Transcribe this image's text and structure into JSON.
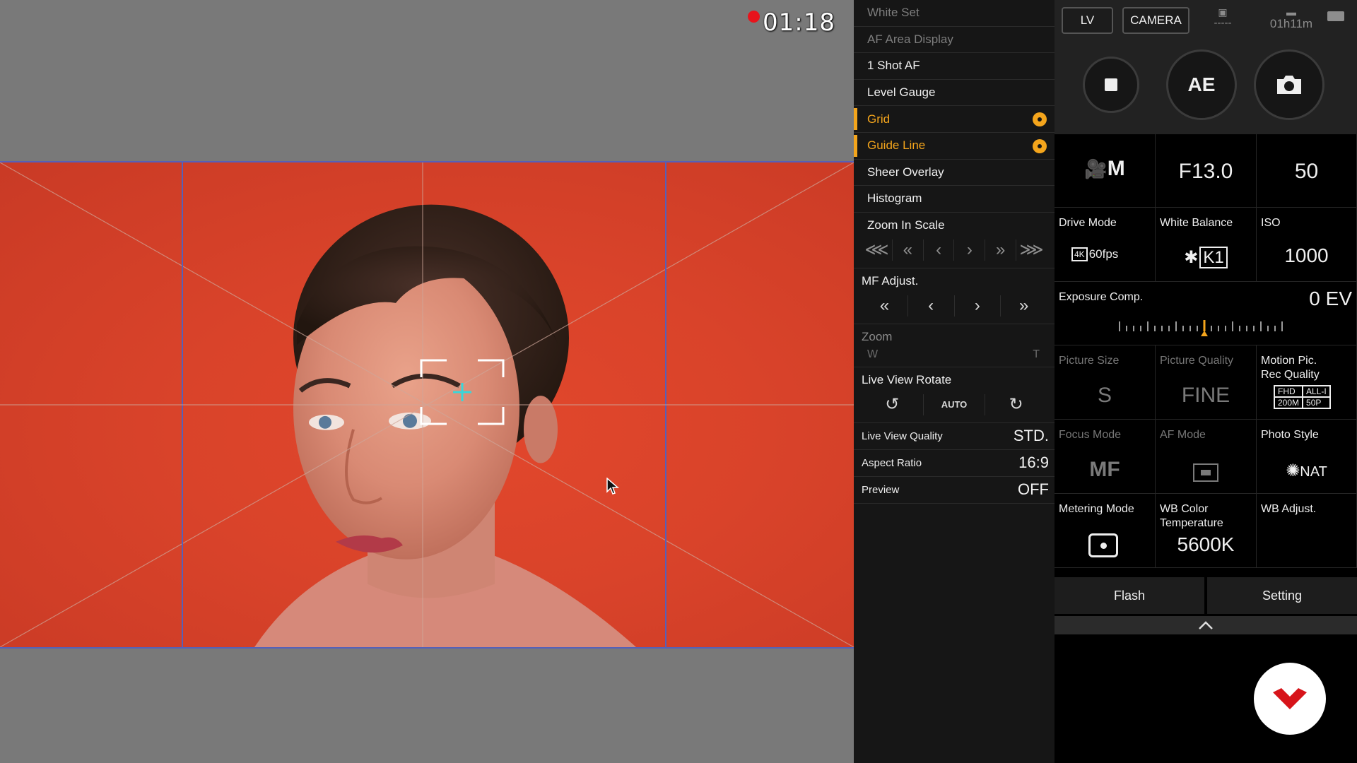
{
  "recording": {
    "time": "01:18"
  },
  "menu": {
    "items": [
      {
        "label": "White Set",
        "state": "dim"
      },
      {
        "label": "AF Area Display",
        "state": "dim"
      },
      {
        "label": "1 Shot AF",
        "state": "normal"
      },
      {
        "label": "Level Gauge",
        "state": "normal"
      },
      {
        "label": "Grid",
        "state": "highlight"
      },
      {
        "label": "Guide Line",
        "state": "highlight"
      },
      {
        "label": "Sheer Overlay",
        "state": "normal"
      },
      {
        "label": "Histogram",
        "state": "normal"
      }
    ],
    "zoom_in_scale": {
      "label": "Zoom In Scale"
    },
    "mf_adjust": {
      "label": "MF Adjust."
    },
    "zoom": {
      "label": "Zoom",
      "wide": "W",
      "tele": "T"
    },
    "live_view_rotate": {
      "label": "Live View Rotate",
      "auto": "AUTO"
    },
    "live_view_quality": {
      "label": "Live View Quality",
      "value": "STD."
    },
    "aspect_ratio": {
      "label": "Aspect Ratio",
      "value": "16:9"
    },
    "preview": {
      "label": "Preview",
      "value": "OFF"
    }
  },
  "panel": {
    "lv_label": "LV",
    "camera_label": "CAMERA",
    "photo_count": "-----",
    "rec_remaining": "01h11m",
    "ae_label": "AE",
    "mode_value": "M",
    "aperture": "F13.0",
    "shutter": "50",
    "drive_mode": {
      "label": "Drive Mode",
      "badge": "4K",
      "fps": "60fps"
    },
    "white_balance": {
      "label": "White Balance",
      "value": "K1"
    },
    "iso": {
      "label": "ISO",
      "value": "1000"
    },
    "exposure_comp": {
      "label": "Exposure Comp.",
      "value": "0 EV"
    },
    "picture_size": {
      "label": "Picture Size",
      "value": "S"
    },
    "picture_quality": {
      "label": "Picture Quality",
      "value": "FINE"
    },
    "motion_quality": {
      "label_1": "Motion Pic.",
      "label_2": "Rec Quality",
      "fhd": "FHD",
      "alli": "ALL-I",
      "bitrate": "200M",
      "fps": "50P"
    },
    "focus_mode": {
      "label": "Focus Mode",
      "value": "MF"
    },
    "af_mode": {
      "label": "AF Mode"
    },
    "photo_style": {
      "label": "Photo Style",
      "value": "NAT"
    },
    "metering_mode": {
      "label": "Metering Mode"
    },
    "wb_color_temp": {
      "label_1": "WB Color",
      "label_2": "Temperature",
      "value": "5600K"
    },
    "wb_adjust": {
      "label": "WB Adjust."
    },
    "flash_label": "Flash",
    "setting_label": "Setting"
  },
  "colors": {
    "accent": "#f4a51c",
    "rec": "#e8131b",
    "backdrop": "#d9432a",
    "brand": "#d7141a"
  }
}
